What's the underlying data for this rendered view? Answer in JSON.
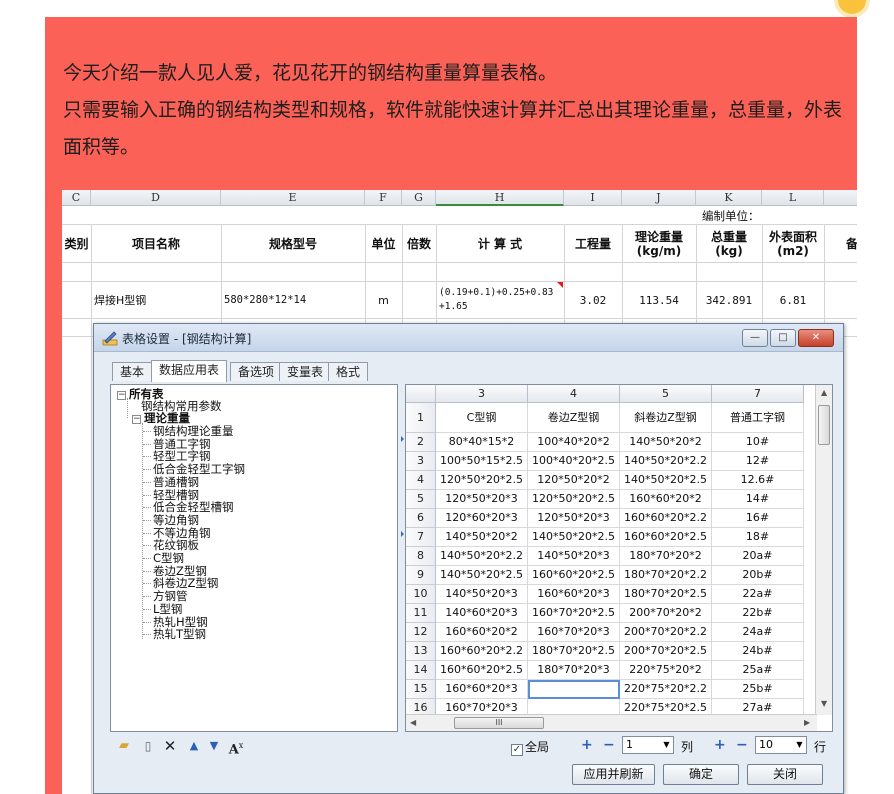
{
  "intro": {
    "line1": " 今天介绍一款人见人爱，花见花开的钢结构重量算量表格。",
    "line2": "只需要输入正确的钢结构类型和规格，软件就能快速计算并汇总出其理论重量，总重量，外表面积等。"
  },
  "sheet": {
    "columns": [
      "C",
      "D",
      "E",
      "F",
      "G",
      "H",
      "I",
      "J",
      "K",
      "L",
      ""
    ],
    "unit_label": "编制单位：",
    "headers": {
      "category": "类别",
      "name": "项目名称",
      "spec": "规格型号",
      "unit": "单位",
      "multiple": "倍数",
      "formula": "计 算 式",
      "quantity": "工程量",
      "theory_weight": "理论重量\n(kg/m)",
      "total_weight": "总重量\n(kg)",
      "surface": "外表面积\n(m2)",
      "remark": "备"
    },
    "row": {
      "name": "焊接H型钢",
      "spec": "580*280*12*14",
      "unit": "m",
      "formula": "(0.19+0.1)+0.25+0.83+1.65",
      "quantity": "3.02",
      "theory_weight": "113.54",
      "total_weight": "342.891",
      "surface": "6.81"
    }
  },
  "dialog": {
    "title": "表格设置 - [钢结构计算]",
    "tabs": [
      "基本",
      "数据应用表",
      "备选项",
      "变量表",
      "格式"
    ],
    "active_tab": 1,
    "tree": {
      "root": "所有表",
      "child1": "钢结构常用参数",
      "group": "理论重量",
      "items": [
        "钢结构理论重量",
        "普通工字钢",
        "轻型工字钢",
        "低合金轻型工字钢",
        "普通槽钢",
        "轻型槽钢",
        "低合金轻型槽钢",
        "等边角钢",
        "不等边角钢",
        "花纹钢板",
        "C型钢",
        "卷边Z型钢",
        "斜卷边Z型钢",
        "方钢管",
        "L型钢",
        "热轧H型钢",
        "热轧T型钢"
      ]
    },
    "grid": {
      "col_headers": [
        "3",
        "4",
        "5",
        "7"
      ],
      "row_headers": [
        "1",
        "2",
        "3",
        "4",
        "5",
        "6",
        "7",
        "8",
        "9",
        "10",
        "11",
        "12",
        "13",
        "14",
        "15",
        "16"
      ],
      "rows": [
        [
          "C型钢",
          "卷边Z型钢",
          "斜卷边Z型钢",
          "普通工字钢"
        ],
        [
          "80*40*15*2",
          "100*40*20*2",
          "140*50*20*2",
          "10#"
        ],
        [
          "100*50*15*2.5",
          "100*40*20*2.5",
          "140*50*20*2.2",
          "12#"
        ],
        [
          "120*50*20*2.5",
          "120*50*20*2",
          "140*50*20*2.5",
          "12.6#"
        ],
        [
          "120*50*20*3",
          "120*50*20*2.5",
          "160*60*20*2",
          "14#"
        ],
        [
          "120*60*20*3",
          "120*50*20*3",
          "160*60*20*2.2",
          "16#"
        ],
        [
          "140*50*20*2",
          "140*50*20*2.5",
          "160*60*20*2.5",
          "18#"
        ],
        [
          "140*50*20*2.2",
          "140*50*20*3",
          "180*70*20*2",
          "20a#"
        ],
        [
          "140*50*20*2.5",
          "160*60*20*2.5",
          "180*70*20*2.2",
          "20b#"
        ],
        [
          "140*50*20*3",
          "160*60*20*3",
          "180*70*20*2.5",
          "22a#"
        ],
        [
          "140*60*20*3",
          "160*70*20*2.5",
          "200*70*20*2",
          "22b#"
        ],
        [
          "160*60*20*2",
          "160*70*20*3",
          "200*70*20*2.2",
          "24a#"
        ],
        [
          "160*60*20*2.2",
          "180*70*20*2.5",
          "200*70*20*2.5",
          "24b#"
        ],
        [
          "160*60*20*2.5",
          "180*70*20*3",
          "220*75*20*2",
          "25a#"
        ],
        [
          "160*60*20*3",
          "",
          "220*75*20*2.2",
          "25b#"
        ],
        [
          "160*70*20*3",
          "",
          "220*75*20*2.5",
          "27a#"
        ]
      ],
      "hscroll_label": "III"
    },
    "toolbar_icons": [
      "folder-icon",
      "new-doc-icon",
      "delete-icon",
      "arrow-up-icon",
      "arrow-down-icon",
      "font-icon"
    ],
    "global_label": "全局",
    "col_value": "1",
    "col_label": "列",
    "row_value": "10",
    "row_label": "行",
    "buttons": {
      "apply": "应用并刷新",
      "ok": "确定",
      "close": "关闭"
    }
  }
}
